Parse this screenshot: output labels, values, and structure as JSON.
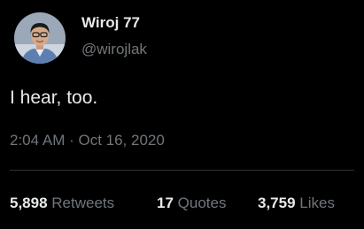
{
  "author": {
    "name": "Wiroj 77",
    "handle": "@wirojlak",
    "avatar_icon": "profile-photo-icon"
  },
  "tweet": {
    "text": "I hear, too.",
    "timestamp": "2:04 AM · Oct 16, 2020"
  },
  "stats": [
    {
      "count": "5,898",
      "label": "Retweets"
    },
    {
      "count": "17",
      "label": "Quotes"
    },
    {
      "count": "3,759",
      "label": "Likes"
    }
  ],
  "colors": {
    "background": "#000000",
    "primary_text": "#e7e9ea",
    "secondary_text": "#71767b",
    "divider": "#2f3336"
  }
}
